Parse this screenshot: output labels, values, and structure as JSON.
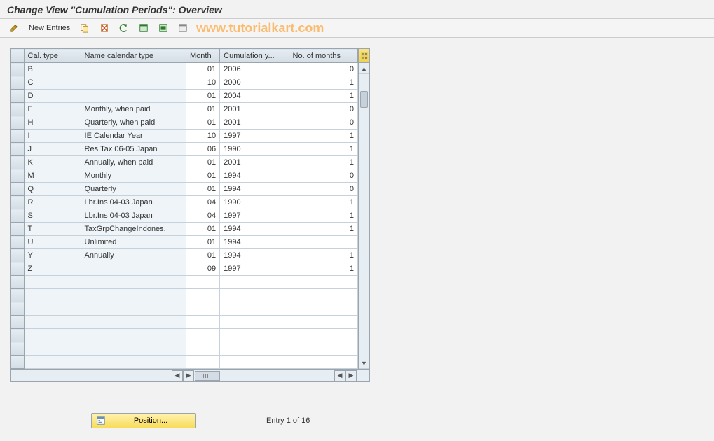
{
  "title": "Change View \"Cumulation Periods\": Overview",
  "watermark": "www.tutorialkart.com",
  "toolbar": {
    "new_entries": "New Entries"
  },
  "table": {
    "headers": {
      "cal_type": "Cal. type",
      "name": "Name calendar type",
      "month": "Month",
      "year": "Cumulation y...",
      "months": "No. of months"
    },
    "rows": [
      {
        "type": "B",
        "name": "",
        "month": "01",
        "year": "2006",
        "months": "0"
      },
      {
        "type": "C",
        "name": "",
        "month": "10",
        "year": "2000",
        "months": "1"
      },
      {
        "type": "D",
        "name": "",
        "month": "01",
        "year": "2004",
        "months": "1"
      },
      {
        "type": "F",
        "name": "Monthly, when paid",
        "month": "01",
        "year": "2001",
        "months": "0"
      },
      {
        "type": "H",
        "name": "Quarterly, when paid",
        "month": "01",
        "year": "2001",
        "months": "0"
      },
      {
        "type": "I",
        "name": "IE Calendar Year",
        "month": "10",
        "year": "1997",
        "months": "1"
      },
      {
        "type": "J",
        "name": "Res.Tax 06-05  Japan",
        "month": "06",
        "year": "1990",
        "months": "1"
      },
      {
        "type": "K",
        "name": "Annually, when paid",
        "month": "01",
        "year": "2001",
        "months": "1"
      },
      {
        "type": "M",
        "name": "Monthly",
        "month": "01",
        "year": "1994",
        "months": "0"
      },
      {
        "type": "Q",
        "name": "Quarterly",
        "month": "01",
        "year": "1994",
        "months": "0"
      },
      {
        "type": "R",
        "name": "Lbr.Ins 04-03  Japan",
        "month": "04",
        "year": "1990",
        "months": "1"
      },
      {
        "type": "S",
        "name": "Lbr.Ins 04-03  Japan",
        "month": "04",
        "year": "1997",
        "months": "1"
      },
      {
        "type": "T",
        "name": "TaxGrpChangeIndones.",
        "month": "01",
        "year": "1994",
        "months": "1"
      },
      {
        "type": "U",
        "name": "Unlimited",
        "month": "01",
        "year": "1994",
        "months": ""
      },
      {
        "type": "Y",
        "name": "Annually",
        "month": "01",
        "year": "1994",
        "months": "1"
      },
      {
        "type": "Z",
        "name": "",
        "month": "09",
        "year": "1997",
        "months": "1"
      },
      {
        "type": "",
        "name": "",
        "month": "",
        "year": "",
        "months": ""
      },
      {
        "type": "",
        "name": "",
        "month": "",
        "year": "",
        "months": ""
      },
      {
        "type": "",
        "name": "",
        "month": "",
        "year": "",
        "months": ""
      },
      {
        "type": "",
        "name": "",
        "month": "",
        "year": "",
        "months": ""
      },
      {
        "type": "",
        "name": "",
        "month": "",
        "year": "",
        "months": ""
      },
      {
        "type": "",
        "name": "",
        "month": "",
        "year": "",
        "months": ""
      },
      {
        "type": "",
        "name": "",
        "month": "",
        "year": "",
        "months": ""
      }
    ]
  },
  "footer": {
    "position": "Position...",
    "entry": "Entry 1 of 16"
  }
}
